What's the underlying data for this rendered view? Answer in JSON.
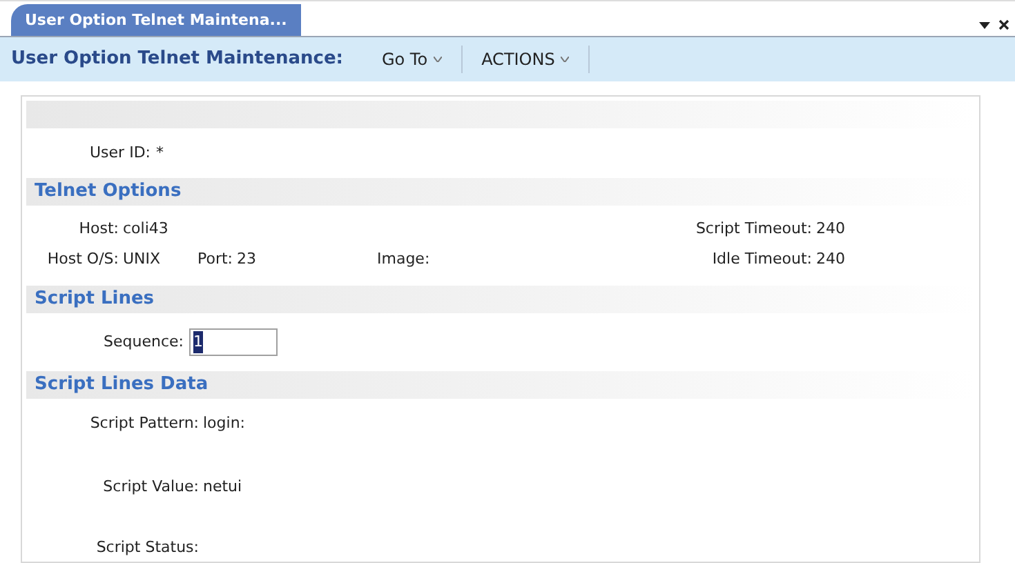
{
  "tab": {
    "label": "User Option Telnet Maintena...",
    "selected": true
  },
  "toolbar": {
    "title": "User Option Telnet Maintenance:",
    "menus": [
      {
        "label": "Go To"
      },
      {
        "label": "ACTIONS"
      }
    ]
  },
  "user_id": {
    "label": "User ID:",
    "required_mark": "*"
  },
  "telnet_options": {
    "title": "Telnet Options",
    "host": {
      "label": "Host:",
      "value": "coli43"
    },
    "script_timeout": {
      "label": "Script Timeout:",
      "value": "240"
    },
    "host_os": {
      "label": "Host O/S:",
      "value": "UNIX"
    },
    "port": {
      "label": "Port:",
      "value": "23"
    },
    "image": {
      "label": "Image:"
    },
    "idle_timeout": {
      "label": "Idle Timeout:",
      "value": "240"
    }
  },
  "script_lines": {
    "title": "Script Lines",
    "sequence": {
      "label": "Sequence:",
      "value": "1",
      "text_selected": true
    }
  },
  "script_lines_data": {
    "title": "Script Lines Data",
    "script_pattern": {
      "label": "Script Pattern:",
      "value": "login:"
    },
    "script_value": {
      "label": "Script Value:",
      "value": "netui"
    },
    "script_status": {
      "label": "Script Status:"
    }
  }
}
